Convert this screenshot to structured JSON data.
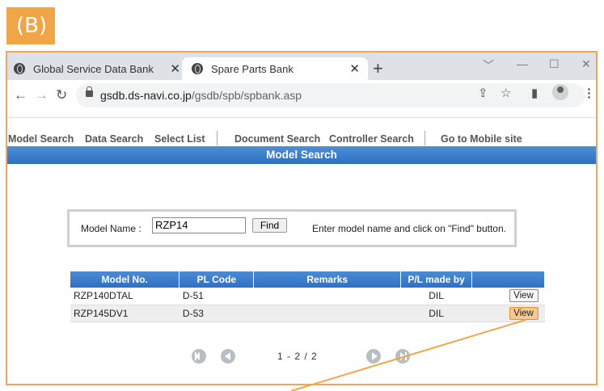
{
  "label": "(B)",
  "browser": {
    "tabs": [
      {
        "title": "Global Service Data Bank",
        "active": false
      },
      {
        "title": "Spare Parts Bank",
        "active": true
      }
    ],
    "new_tab_symbol": "+",
    "url_host": "gsdb.ds-navi.co.jp",
    "url_path": "/gsdb/spb/spbank.asp"
  },
  "site_menu": {
    "items": [
      "Model Search",
      "Data Search",
      "Select List",
      "Document Search",
      "Controller Search",
      "Go to Mobile site"
    ]
  },
  "page_title": "Model Search",
  "search": {
    "label": "Model Name :",
    "value": "RZP14",
    "find_label": "Find",
    "hint": "Enter model name and click on \"Find\" button."
  },
  "results": {
    "headers": [
      "Model No.",
      "PL Code",
      "Remarks",
      "P/L made by",
      ""
    ],
    "rows": [
      {
        "model": "RZP140DTAL",
        "pl_code": "D-51",
        "remarks": "",
        "made_by": "DIL",
        "action": "View"
      },
      {
        "model": "RZP145DV1",
        "pl_code": "D-53",
        "remarks": "",
        "made_by": "DIL",
        "action": "View"
      }
    ]
  },
  "pager": {
    "text": "1 - 2 / 2"
  },
  "colors": {
    "accent_orange": "#f0a548",
    "header_blue": "#2e70c2",
    "highlight_button": "#f8c98e"
  },
  "icons": [
    "globe-icon",
    "close-icon",
    "plus-icon",
    "back-icon",
    "forward-icon",
    "reload-icon",
    "lock-icon",
    "share-icon",
    "star-icon",
    "sidebar-icon",
    "profile-icon",
    "menu-icon",
    "first-page-icon",
    "prev-page-icon",
    "next-page-icon",
    "last-page-icon"
  ]
}
